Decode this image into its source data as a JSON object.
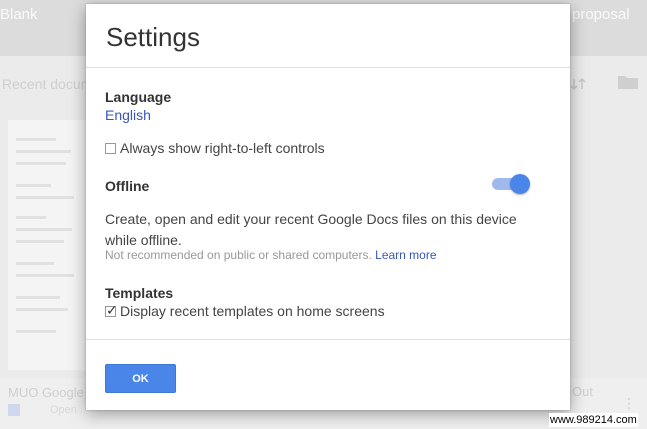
{
  "background": {
    "top_left_text": "Blank",
    "top_right_text": "proposal",
    "recent_label": "Recent documents",
    "doc_title": "MUO Google",
    "doc_subtitle": "Open",
    "right_text": "Out",
    "more_icon": "⋮"
  },
  "dialog": {
    "title": "Settings",
    "language": {
      "label": "Language",
      "value": "English"
    },
    "rtl_checkbox_label": "Always show right-to-left controls",
    "offline": {
      "label": "Offline",
      "enabled": true,
      "description": "Create, open and edit your recent Google Docs files on this device while offline.",
      "note": "Not recommended on public or shared computers.",
      "learn_more": "Learn more"
    },
    "templates": {
      "label": "Templates",
      "checkbox_label": "Display recent templates on home screens",
      "checked": true
    },
    "ok_label": "OK"
  },
  "watermark": "www.989214.com",
  "colors": {
    "link": "#3b56b8",
    "accent": "#4a86e8",
    "toggle_track": "#9fb9ee"
  }
}
